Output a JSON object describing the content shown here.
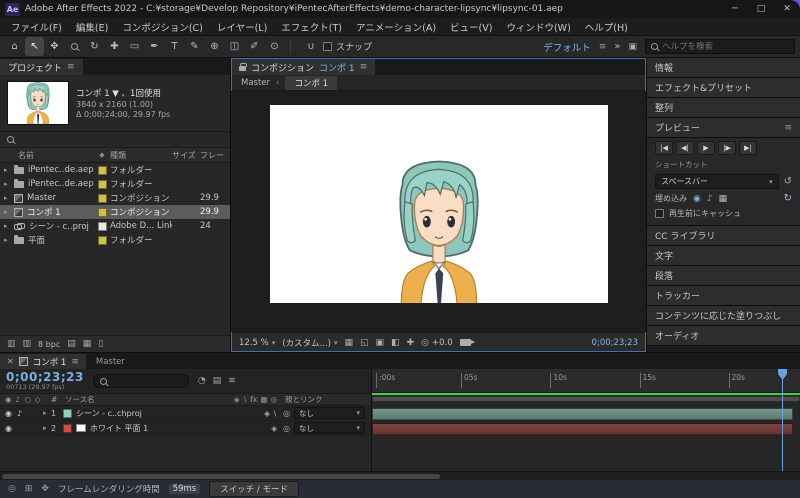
{
  "window": {
    "title": "Adobe After Effects 2022 - C:¥storage¥Develop Repository¥iPentecAfterEffects¥demo-character-lipsync¥lipsync-01.aep",
    "app_badge": "Ae",
    "minimize": "─",
    "maximize": "□",
    "close": "✕"
  },
  "menu": {
    "items": [
      "ファイル(F)",
      "編集(E)",
      "コンポジション(C)",
      "レイヤー(L)",
      "エフェクト(T)",
      "アニメーション(A)",
      "ビュー(V)",
      "ウィンドウ(W)",
      "ヘルプ(H)"
    ]
  },
  "toolbar": {
    "tools": [
      {
        "name": "home",
        "glyph": "⌂"
      },
      {
        "name": "selection",
        "glyph": "↖"
      },
      {
        "name": "hand",
        "glyph": "✥"
      },
      {
        "name": "zoom",
        "glyph": ""
      },
      {
        "name": "orbit",
        "glyph": "↻"
      },
      {
        "name": "pan-behind",
        "glyph": "✚"
      },
      {
        "name": "shape",
        "glyph": "▭"
      },
      {
        "name": "pen",
        "glyph": "✒"
      },
      {
        "name": "type",
        "glyph": "T"
      },
      {
        "name": "brush",
        "glyph": "✎"
      },
      {
        "name": "clone-stamp",
        "glyph": "⊕"
      },
      {
        "name": "eraser",
        "glyph": "◫"
      },
      {
        "name": "roto-brush",
        "glyph": "✐"
      },
      {
        "name": "puppet",
        "glyph": "⊙"
      }
    ],
    "snap_label": "スナップ",
    "workspace": "デフォルト",
    "overflow": "»",
    "share": "▣",
    "search_placeholder": "ヘルプを検索"
  },
  "project": {
    "tab": "プロジェクト",
    "preview": {
      "line1": "コンポ 1 ▼ 、1回使用",
      "line2": "3840 x 2160 (1.00)",
      "line3": "Δ 0;00;24;00, 29.97 fps"
    },
    "columns": {
      "name": "名前",
      "label": "◆",
      "type": "種類",
      "size": "サイズ",
      "frame": "フレー"
    },
    "rows": [
      {
        "name": "iPentec..de.aep",
        "type": "フォルダー",
        "size": "",
        "frame": "",
        "label_color": "#cdbf4f"
      },
      {
        "name": "iPentec..de.aep",
        "type": "フォルダー",
        "size": "",
        "frame": "",
        "label_color": "#cdbf4f"
      },
      {
        "name": "Master",
        "type": "コンポジション",
        "size": "",
        "frame": "29.9",
        "label_color": "#cdbf4f"
      },
      {
        "name": "コンポ 1",
        "type": "コンポジション",
        "size": "",
        "frame": "29.9",
        "label_color": "#cdbf4f"
      },
      {
        "name": "シーン - c..proj",
        "type": "Adobe D... Link",
        "size": "",
        "frame": "24",
        "label_color": "#e8e8e8"
      },
      {
        "name": "平面",
        "type": "フォルダー",
        "size": "",
        "frame": "",
        "label_color": "#cdbf4f"
      }
    ],
    "bpc": "8 bpc"
  },
  "comp": {
    "panel_title": "コンポジション",
    "comp_name": "コンポ 1",
    "crumb_master": "Master",
    "crumb_sep": "‹",
    "zoom": "12.5 %",
    "quality": "(カスタム...)",
    "exposure": "+0.0",
    "timecode": "0;00;23;23",
    "icons": [
      "▦",
      "◱",
      "▣",
      "◧",
      "✚"
    ]
  },
  "sidebar": {
    "info": "情報",
    "effects": "エフェクト&プリセット",
    "align": "整列",
    "preview": "プレビュー",
    "transport": [
      "|◀",
      "◀|",
      "▶",
      "|▶",
      "▶|"
    ],
    "shortcut_label": "ショートカット",
    "shortcut_value": "スペースバー",
    "include_label": "埋め込み",
    "cache_label": "再生前にキャッシュ",
    "libraries": "CC ライブラリ",
    "character": "文字",
    "paragraph": "段落",
    "tracker": "トラッカー",
    "content_fill": "コンテンツに応じた塗りつぶし",
    "audio": "オーディオ"
  },
  "timeline": {
    "tab_comp": "コンポ 1",
    "tab_master": "Master",
    "timecode": "0;00;23;23",
    "frame_info": "00713 (29.97 fps)",
    "icons": [
      "◔",
      "▤",
      "≋"
    ],
    "columns": {
      "source": "ソース名",
      "parent": "親とリンク",
      "switches": [
        "◈",
        "∖",
        "fx",
        "▦",
        "◎"
      ]
    },
    "ruler": [
      ":00s",
      "05s",
      "10s",
      "15s",
      "20s"
    ],
    "layers": [
      {
        "num": "1",
        "name": "シーン - c..chproj",
        "parent": "なし",
        "label_color": "#8fd0c4",
        "switches": "◈ ∖"
      },
      {
        "num": "2",
        "name": "ホワイト 平面 1",
        "parent": "なし",
        "label_color": "#d14b41",
        "switches": "◈"
      }
    ]
  },
  "status": {
    "icons": [
      "◎",
      "⊞",
      "✥"
    ],
    "render_label": "フレームレンダリング時間",
    "render_time": "59ms",
    "switch_label": "スイッチ / モード"
  },
  "icons": {
    "panel_menu": "≡",
    "chevron_down": "▾",
    "twirl": "▸",
    "close": "✕",
    "reset": "↺",
    "loop": "↻",
    "eye": "◉",
    "audio": "♪",
    "frame_box": "▦",
    "pick_whip": "◎",
    "magnet": "∪",
    "aperture": "◎"
  },
  "colors": {
    "accent_blue": "#4a90d9",
    "timecode_blue": "#79aee2",
    "cache_green": "#3ecf52",
    "label_yellow": "#cdbf4f"
  }
}
